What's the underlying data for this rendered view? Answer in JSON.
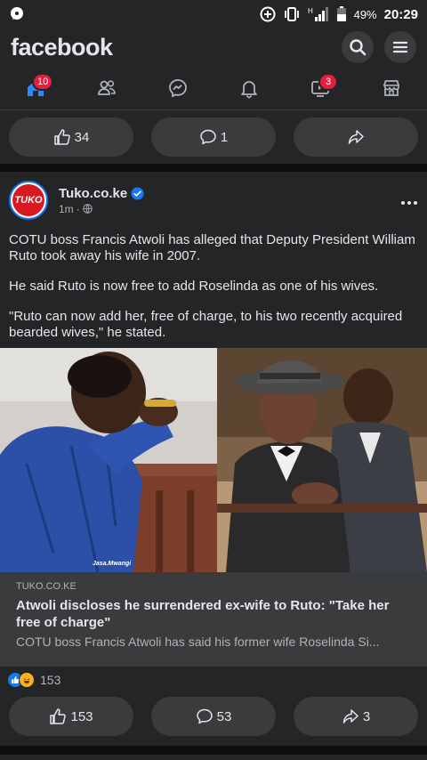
{
  "status_bar": {
    "battery": "49%",
    "time": "20:29",
    "network": "H"
  },
  "header": {
    "logo": "facebook",
    "icons": [
      "search-icon",
      "menu-icon"
    ]
  },
  "nav": {
    "tabs": [
      {
        "icon": "home-icon",
        "badge": "10",
        "active": true
      },
      {
        "icon": "friends-icon",
        "badge": ""
      },
      {
        "icon": "messenger-icon",
        "badge": ""
      },
      {
        "icon": "notifications-icon",
        "badge": ""
      },
      {
        "icon": "watch-icon",
        "badge": "3"
      },
      {
        "icon": "marketplace-icon",
        "badge": ""
      }
    ]
  },
  "prev_post_actions": {
    "likes": "34",
    "comments": "1"
  },
  "post": {
    "author": "Tuko.co.ke",
    "avatar_text": "TUKO",
    "time": "1m",
    "paragraphs": [
      "COTU boss Francis Atwoli has alleged that Deputy President William Ruto took away his wife in 2007.",
      "He said Ruto is now free to add Roselinda as one of his wives.",
      "\"Ruto can now add her, free of charge, to his  two recently acquired bearded wives,\" he stated."
    ],
    "photo_watermark": "Jasa.Mwangi",
    "link": {
      "source": "TUKO.CO.KE",
      "title": "Atwoli discloses he surrendered ex-wife to Ruto: \"Take her free of charge\"",
      "description": "COTU boss Francis Atwoli has said his former wife Roselinda Si..."
    },
    "reaction_count": "153",
    "actions": {
      "likes": "153",
      "comments": "53",
      "shares": "3"
    }
  },
  "colors": {
    "background": "#18191a",
    "surface": "#242526",
    "button": "#3a3b3c",
    "accent": "#1877f2",
    "badge": "#e41e3f"
  }
}
